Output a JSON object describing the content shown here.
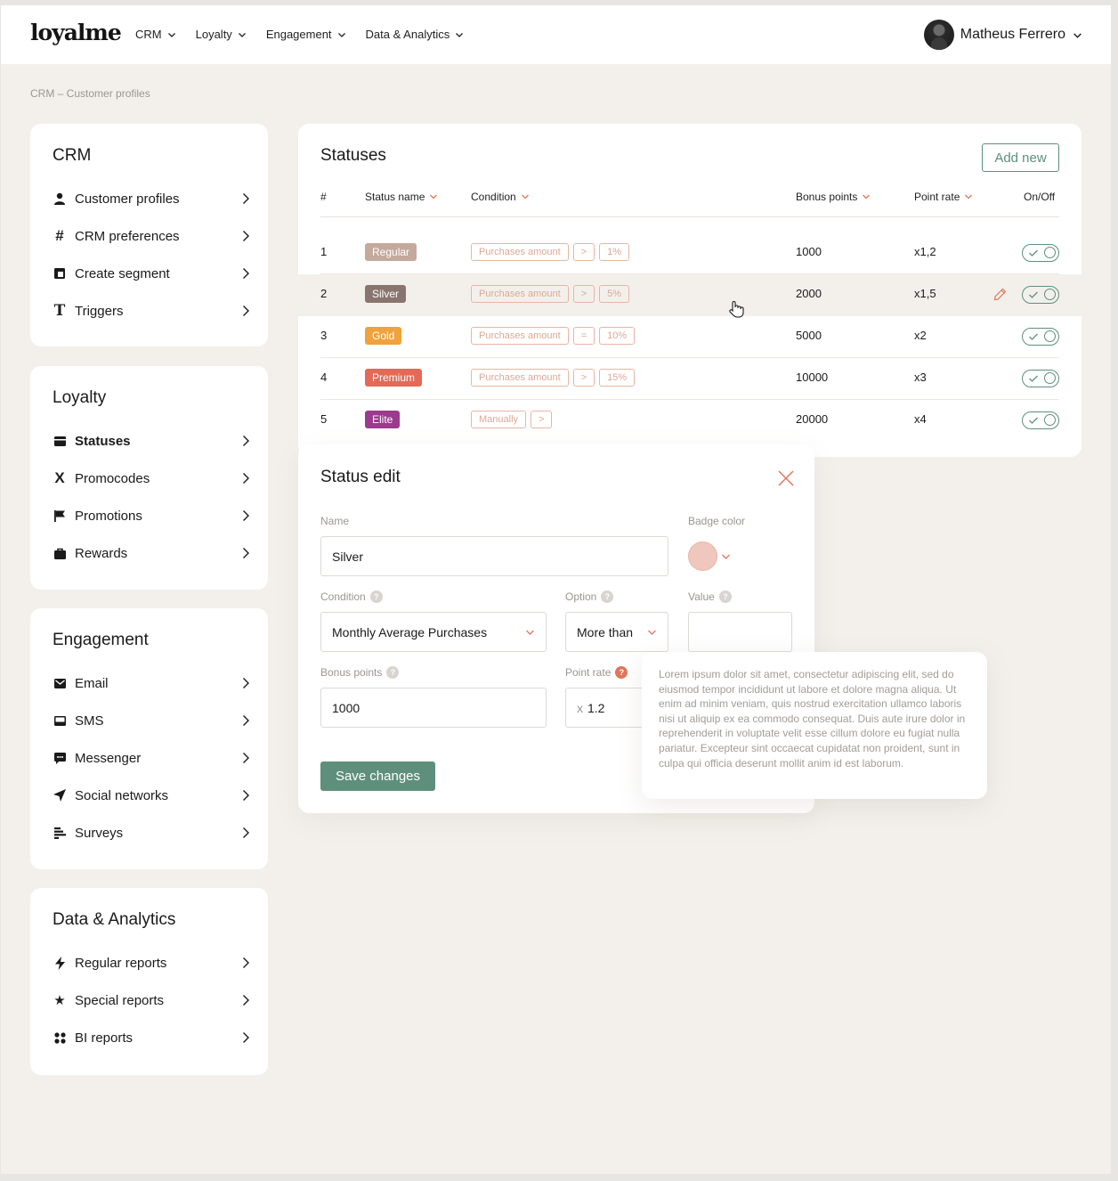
{
  "app": {
    "logo": "loyalme"
  },
  "nav": [
    {
      "label": "CRM"
    },
    {
      "label": "Loyalty"
    },
    {
      "label": "Engagement"
    },
    {
      "label": "Data & Analytics"
    }
  ],
  "user": {
    "name": "Matheus Ferrero"
  },
  "breadcrumb": "CRM – Customer profiles",
  "sidebar": {
    "crm": {
      "title": "CRM",
      "items": [
        {
          "label": "Customer profiles",
          "icon": "user-icon"
        },
        {
          "label": "CRM preferences",
          "icon": "hash-icon"
        },
        {
          "label": "Create segment",
          "icon": "segment-icon"
        },
        {
          "label": "Triggers",
          "icon": "text-t-icon"
        }
      ]
    },
    "loyalty": {
      "title": "Loyalty",
      "items": [
        {
          "label": "Statuses",
          "icon": "card-icon",
          "active": true
        },
        {
          "label": "Promocodes",
          "icon": "x-icon"
        },
        {
          "label": "Promotions",
          "icon": "flag-icon"
        },
        {
          "label": "Rewards",
          "icon": "bag-icon"
        }
      ]
    },
    "engagement": {
      "title": "Engagement",
      "items": [
        {
          "label": "Email",
          "icon": "mail-icon"
        },
        {
          "label": "SMS",
          "icon": "sms-icon"
        },
        {
          "label": "Messenger",
          "icon": "chat-icon"
        },
        {
          "label": "Social networks",
          "icon": "send-icon"
        },
        {
          "label": "Surveys",
          "icon": "list-icon"
        }
      ]
    },
    "analytics": {
      "title": "Data & Analytics",
      "items": [
        {
          "label": "Regular reports",
          "icon": "bolt-icon"
        },
        {
          "label": "Special reports",
          "icon": "star-icon"
        },
        {
          "label": "BI reports",
          "icon": "grid-dots-icon"
        }
      ]
    }
  },
  "statuses": {
    "title": "Statuses",
    "add_label": "Add new",
    "columns": {
      "num": "#",
      "name": "Status name",
      "condition": "Condition",
      "bonus": "Bonus points",
      "rate": "Point rate",
      "onoff": "On/Off"
    },
    "rows": [
      {
        "num": "1",
        "name": "Regular",
        "color": "#c4a99c",
        "cond": [
          "Purchases amount",
          ">",
          "1%"
        ],
        "bonus": "1000",
        "rate": "x1,2",
        "on": true
      },
      {
        "num": "2",
        "name": "Silver",
        "color": "#8a7470",
        "cond": [
          "Purchases amount",
          ">",
          "5%"
        ],
        "bonus": "2000",
        "rate": "x1,5",
        "on": true
      },
      {
        "num": "3",
        "name": "Gold",
        "color": "#f0a23c",
        "cond": [
          "Purchases amount",
          "=",
          "10%"
        ],
        "bonus": "5000",
        "rate": "x2",
        "on": true
      },
      {
        "num": "4",
        "name": "Premium",
        "color": "#e26a57",
        "cond": [
          "Purchases amount",
          ">",
          "15%"
        ],
        "bonus": "10000",
        "rate": "x3",
        "on": true
      },
      {
        "num": "5",
        "name": "Elite",
        "color": "#9b3a8e",
        "cond": [
          "Manually",
          ">"
        ],
        "bonus": "20000",
        "rate": "x4",
        "on": true
      }
    ]
  },
  "edit": {
    "title": "Status edit",
    "name_label": "Name",
    "name_value": "Silver",
    "badge_color_label": "Badge color",
    "badge_color": "#efc7bd",
    "condition_label": "Condition",
    "condition_value": "Monthly Average Purchases",
    "option_label": "Option",
    "option_value": "More than",
    "value_label": "Value",
    "value_value": "",
    "bonus_label": "Bonus points",
    "bonus_value": "1000",
    "rate_label": "Point rate",
    "rate_prefix": "x",
    "rate_value": "1.2",
    "save_label": "Save changes"
  },
  "tooltip": {
    "text": "Lorem ipsum dolor sit amet, consectetur adipiscing elit, sed do eiusmod tempor incididunt ut labore et dolore magna aliqua. Ut enim ad minim veniam, quis nostrud exercitation ullamco laboris nisi ut aliquip ex ea commodo consequat. Duis aute irure dolor in reprehenderit in voluptate velit esse cillum dolore eu fugiat nulla pariatur. Excepteur sint occaecat cupidatat non proident, sunt in culpa qui officia deserunt mollit anim id est laborum."
  },
  "colors": {
    "accent": "#5e8f7c",
    "alert": "#e0765c",
    "chip_border": "#e8b5a4"
  }
}
